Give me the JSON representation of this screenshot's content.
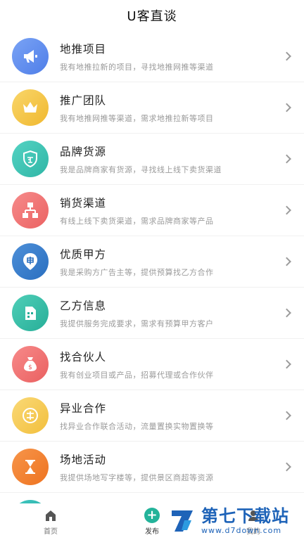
{
  "header": {
    "title": "U客直谈"
  },
  "items": [
    {
      "title": "地推项目",
      "subtitle": "我有地推拉新的项目，寻找地推网推等渠道",
      "icon": "megaphone-icon",
      "color_from": "#7aa3f5",
      "color_to": "#4f7ee8"
    },
    {
      "title": "推广团队",
      "subtitle": "我有地推网推等渠道，需求地推拉新等项目",
      "icon": "crown-icon",
      "color_from": "#f9d66a",
      "color_to": "#f0b82f"
    },
    {
      "title": "品牌货源",
      "subtitle": "我是品牌商家有货源，寻找线上线下卖货渠道",
      "icon": "shield-icon",
      "color_from": "#54d3c3",
      "color_to": "#2fb6a6"
    },
    {
      "title": "销货渠道",
      "subtitle": "有线上线下卖货渠道，需求品牌商家等产品",
      "icon": "network-icon",
      "color_from": "#f68b8b",
      "color_to": "#eb6262"
    },
    {
      "title": "优质甲方",
      "subtitle": "我是采购方广告主等，提供预算找乙方合作",
      "icon": "location-pin-icon",
      "color_from": "#4d8fd8",
      "color_to": "#2a6fc0"
    },
    {
      "title": "乙方信息",
      "subtitle": "我提供服务完成要求，需求有预算甲方客户",
      "icon": "building-icon",
      "color_from": "#4fcfb8",
      "color_to": "#27ae98"
    },
    {
      "title": "找合伙人",
      "subtitle": "我有创业项目或产品，招募代理或合作伙伴",
      "icon": "money-bag-icon",
      "color_from": "#f78a8a",
      "color_to": "#ea6060"
    },
    {
      "title": "异业合作",
      "subtitle": "找异业合作联合活动，流量置换实物置换等",
      "icon": "exchange-icon",
      "color_from": "#fad977",
      "color_to": "#f2bf3c"
    },
    {
      "title": "场地活动",
      "subtitle": "我提供场地写字楼等，提供景区商超等资源",
      "icon": "hourglass-icon",
      "color_from": "#f7954a",
      "color_to": "#ee7320"
    }
  ],
  "tabbar": {
    "home_label": "首页",
    "publish_label": "发布",
    "mine_label": "我的",
    "publish_symbol": "+"
  },
  "watermark": {
    "main": "第七下载站",
    "url": "www.d7down.com"
  }
}
